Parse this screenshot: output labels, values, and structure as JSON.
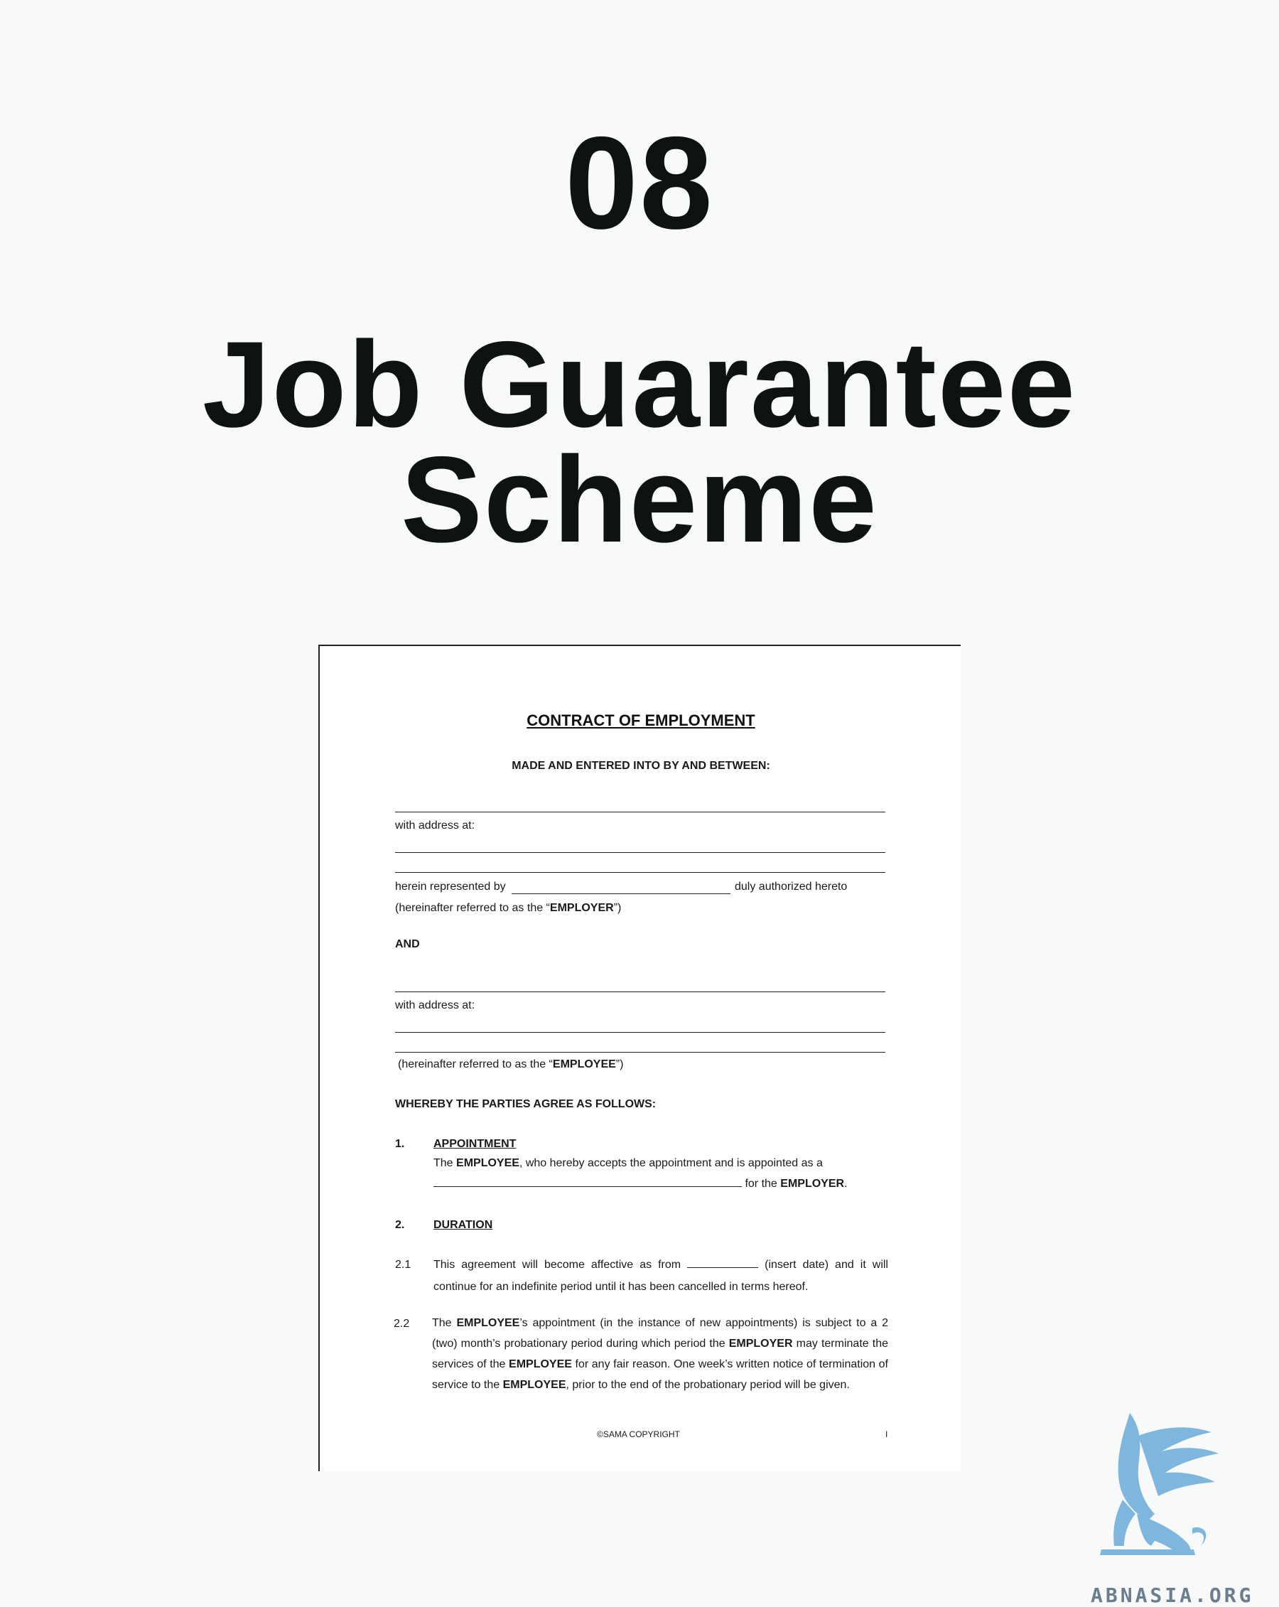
{
  "header": {
    "number": "08",
    "title_line1": "Job Guarantee",
    "title_line2": "Scheme"
  },
  "document": {
    "title": "CONTRACT OF EMPLOYMENT",
    "made": "MADE AND ENTERED INTO BY AND BETWEEN:",
    "with_address_1": "with address at:",
    "herein_represented": "herein represented by",
    "duly_authorized": "duly authorized hereto",
    "employer_ref_pre": "(hereinafter referred to as the “",
    "employer_word": "EMPLOYER",
    "employer_ref_post": "”)",
    "and": "AND",
    "with_address_2": "with address at:",
    "employee_ref_pre": "(hereinafter referred to as the “",
    "employee_word": "EMPLOYEE",
    "employee_ref_post": "”)",
    "whereby": "WHEREBY THE PARTIES AGREE AS FOLLOWS:",
    "s1_num": "1.",
    "s1_title": "APPOINTMENT",
    "s1_text_a": "The ",
    "s1_employee": "EMPLOYEE",
    "s1_text_b": ", who hereby accepts the appointment and is appointed as a",
    "s1_text_c": "for the ",
    "s1_employer": "EMPLOYER",
    "s1_text_d": ".",
    "s2_num": "2.",
    "s2_title": "DURATION",
    "s21_num": "2.1",
    "s21_text_a": "This agreement will become affective as from",
    "s21_text_b": "(insert date) and it will continue for an indefinite period until it has been cancelled in terms hereof.",
    "s22_num": "2.2",
    "s22_a": "The ",
    "s22_employee1": "EMPLOYEE",
    "s22_b": "’s appointment (in the instance of new appointments) is subject to a 2 (two) month’s probationary period during which period the ",
    "s22_employer": "EMPLOYER",
    "s22_c": " may terminate the services of the ",
    "s22_employee2": "EMPLOYEE",
    "s22_d": " for any fair reason. One week’s written notice of termination of service to the ",
    "s22_employee3": "EMPLOYEE",
    "s22_e": ", prior to the end of the probationary period will be given.",
    "footer_copyright": "©SAMA COPYRIGHT",
    "page_number": "I"
  },
  "watermark": {
    "text": "ABNASIA.ORG",
    "color": "#7fb6dd"
  }
}
